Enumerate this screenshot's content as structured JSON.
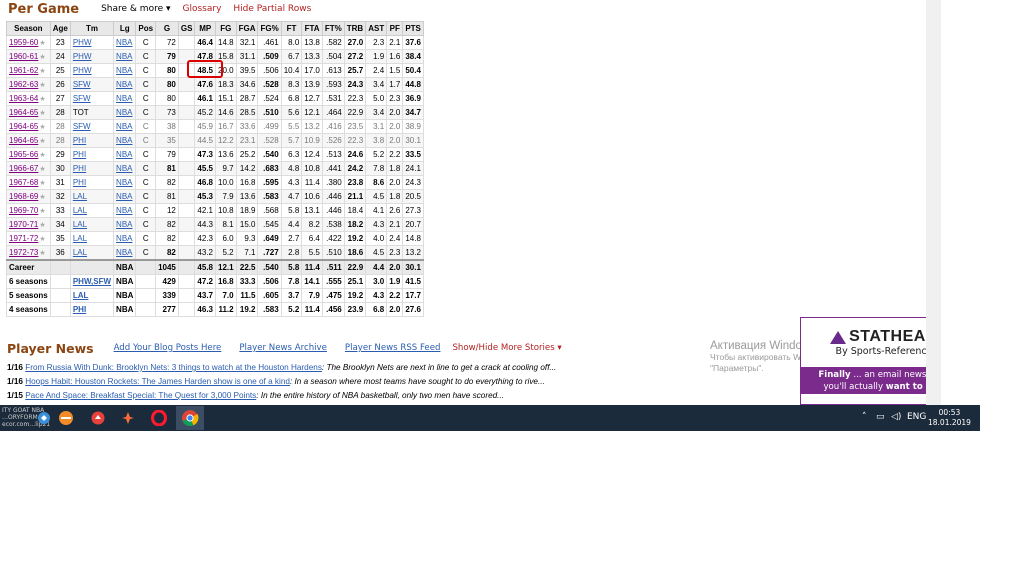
{
  "section": {
    "title": "Per Game",
    "share_label": "Share & more ▾",
    "glossary_label": "Glossary",
    "hide_partial_label": "Hide Partial Rows"
  },
  "table": {
    "headers": [
      "Season",
      "Age",
      "Tm",
      "Lg",
      "Pos",
      "G",
      "GS",
      "MP",
      "FG",
      "FGA",
      "FG%",
      "FT",
      "FTA",
      "FT%",
      "TRB",
      "AST",
      "PF",
      "PTS"
    ],
    "rows": [
      {
        "season": "1959-60",
        "age": "23",
        "tm": "PHW",
        "lg": "NBA",
        "pos": "C",
        "g": "72",
        "gs": "",
        "mp": "46.4",
        "fg": "14.8",
        "fga": "32.1",
        "fgp": ".461",
        "ft": "8.0",
        "fta": "13.8",
        "ftp": ".582",
        "trb": "27.0",
        "ast": "2.3",
        "pf": "2.1",
        "pts": "37.6",
        "bold": [
          "mp",
          "trb",
          "pts"
        ]
      },
      {
        "season": "1960-61",
        "age": "24",
        "tm": "PHW",
        "lg": "NBA",
        "pos": "C",
        "g": "79",
        "gs": "",
        "mp": "47.8",
        "fg": "15.8",
        "fga": "31.1",
        "fgp": ".509",
        "ft": "6.7",
        "fta": "13.3",
        "ftp": ".504",
        "trb": "27.2",
        "ast": "1.9",
        "pf": "1.6",
        "pts": "38.4",
        "bold": [
          "g",
          "mp",
          "fgp",
          "trb",
          "pts"
        ]
      },
      {
        "season": "1961-62",
        "age": "25",
        "tm": "PHW",
        "lg": "NBA",
        "pos": "C",
        "g": "80",
        "gs": "",
        "mp": "48.5",
        "fg": "20.0",
        "fga": "39.5",
        "fgp": ".506",
        "ft": "10.4",
        "fta": "17.0",
        "ftp": ".613",
        "trb": "25.7",
        "ast": "2.4",
        "pf": "1.5",
        "pts": "50.4",
        "bold": [
          "g",
          "mp",
          "trb",
          "pts"
        ]
      },
      {
        "season": "1962-63",
        "age": "26",
        "tm": "SFW",
        "lg": "NBA",
        "pos": "C",
        "g": "80",
        "gs": "",
        "mp": "47.6",
        "fg": "18.3",
        "fga": "34.6",
        "fgp": ".528",
        "ft": "8.3",
        "fta": "13.9",
        "ftp": ".593",
        "trb": "24.3",
        "ast": "3.4",
        "pf": "1.7",
        "pts": "44.8",
        "bold": [
          "g",
          "mp",
          "fgp",
          "trb",
          "pts"
        ]
      },
      {
        "season": "1963-64",
        "age": "27",
        "tm": "SFW",
        "lg": "NBA",
        "pos": "C",
        "g": "80",
        "gs": "",
        "mp": "46.1",
        "fg": "15.1",
        "fga": "28.7",
        "fgp": ".524",
        "ft": "6.8",
        "fta": "12.7",
        "ftp": ".531",
        "trb": "22.3",
        "ast": "5.0",
        "pf": "2.3",
        "pts": "36.9",
        "bold": [
          "mp",
          "pts"
        ]
      },
      {
        "season": "1964-65",
        "age": "28",
        "tm": "TOT",
        "lg": "NBA",
        "pos": "C",
        "g": "73",
        "gs": "",
        "mp": "45.2",
        "fg": "14.6",
        "fga": "28.5",
        "fgp": ".510",
        "ft": "5.6",
        "fta": "12.1",
        "ftp": ".464",
        "trb": "22.9",
        "ast": "3.4",
        "pf": "2.0",
        "pts": "34.7",
        "bold": [
          "fgp",
          "pts"
        ]
      },
      {
        "season": "1964-65",
        "age": "28",
        "tm": "SFW",
        "lg": "NBA",
        "pos": "C",
        "g": "38",
        "gs": "",
        "mp": "45.9",
        "fg": "16.7",
        "fga": "33.6",
        "fgp": ".499",
        "ft": "5.5",
        "fta": "13.2",
        "ftp": ".416",
        "trb": "23.5",
        "ast": "3.1",
        "pf": "2.0",
        "pts": "38.9",
        "bold": [],
        "partial": true
      },
      {
        "season": "1964-65",
        "age": "28",
        "tm": "PHI",
        "lg": "NBA",
        "pos": "C",
        "g": "35",
        "gs": "",
        "mp": "44.5",
        "fg": "12.2",
        "fga": "23.1",
        "fgp": ".528",
        "ft": "5.7",
        "fta": "10.9",
        "ftp": ".526",
        "trb": "22.3",
        "ast": "3.8",
        "pf": "2.0",
        "pts": "30.1",
        "bold": [],
        "partial": true
      },
      {
        "season": "1965-66",
        "age": "29",
        "tm": "PHI",
        "lg": "NBA",
        "pos": "C",
        "g": "79",
        "gs": "",
        "mp": "47.3",
        "fg": "13.6",
        "fga": "25.2",
        "fgp": ".540",
        "ft": "6.3",
        "fta": "12.4",
        "ftp": ".513",
        "trb": "24.6",
        "ast": "5.2",
        "pf": "2.2",
        "pts": "33.5",
        "bold": [
          "mp",
          "fgp",
          "trb",
          "pts"
        ]
      },
      {
        "season": "1966-67",
        "age": "30",
        "tm": "PHI",
        "lg": "NBA",
        "pos": "C",
        "g": "81",
        "gs": "",
        "mp": "45.5",
        "fg": "9.7",
        "fga": "14.2",
        "fgp": ".683",
        "ft": "4.8",
        "fta": "10.8",
        "ftp": ".441",
        "trb": "24.2",
        "ast": "7.8",
        "pf": "1.8",
        "pts": "24.1",
        "bold": [
          "g",
          "mp",
          "fgp",
          "trb"
        ]
      },
      {
        "season": "1967-68",
        "age": "31",
        "tm": "PHI",
        "lg": "NBA",
        "pos": "C",
        "g": "82",
        "gs": "",
        "mp": "46.8",
        "fg": "10.0",
        "fga": "16.8",
        "fgp": ".595",
        "ft": "4.3",
        "fta": "11.4",
        "ftp": ".380",
        "trb": "23.8",
        "ast": "8.6",
        "pf": "2.0",
        "pts": "24.3",
        "bold": [
          "mp",
          "fgp",
          "trb",
          "ast"
        ]
      },
      {
        "season": "1968-69",
        "age": "32",
        "tm": "LAL",
        "lg": "NBA",
        "pos": "C",
        "g": "81",
        "gs": "",
        "mp": "45.3",
        "fg": "7.9",
        "fga": "13.6",
        "fgp": ".583",
        "ft": "4.7",
        "fta": "10.6",
        "ftp": ".446",
        "trb": "21.1",
        "ast": "4.5",
        "pf": "1.8",
        "pts": "20.5",
        "bold": [
          "mp",
          "fgp",
          "trb"
        ]
      },
      {
        "season": "1969-70",
        "age": "33",
        "tm": "LAL",
        "lg": "NBA",
        "pos": "C",
        "g": "12",
        "gs": "",
        "mp": "42.1",
        "fg": "10.8",
        "fga": "18.9",
        "fgp": ".568",
        "ft": "5.8",
        "fta": "13.1",
        "ftp": ".446",
        "trb": "18.4",
        "ast": "4.1",
        "pf": "2.6",
        "pts": "27.3",
        "bold": []
      },
      {
        "season": "1970-71",
        "age": "34",
        "tm": "LAL",
        "lg": "NBA",
        "pos": "C",
        "g": "82",
        "gs": "",
        "mp": "44.3",
        "fg": "8.1",
        "fga": "15.0",
        "fgp": ".545",
        "ft": "4.4",
        "fta": "8.2",
        "ftp": ".538",
        "trb": "18.2",
        "ast": "4.3",
        "pf": "2.1",
        "pts": "20.7",
        "bold": [
          "trb"
        ]
      },
      {
        "season": "1971-72",
        "age": "35",
        "tm": "LAL",
        "lg": "NBA",
        "pos": "C",
        "g": "82",
        "gs": "",
        "mp": "42.3",
        "fg": "6.0",
        "fga": "9.3",
        "fgp": ".649",
        "ft": "2.7",
        "fta": "6.4",
        "ftp": ".422",
        "trb": "19.2",
        "ast": "4.0",
        "pf": "2.4",
        "pts": "14.8",
        "bold": [
          "fgp",
          "trb"
        ]
      },
      {
        "season": "1972-73",
        "age": "36",
        "tm": "LAL",
        "lg": "NBA",
        "pos": "C",
        "g": "82",
        "gs": "",
        "mp": "43.2",
        "fg": "5.2",
        "fga": "7.1",
        "fgp": ".727",
        "ft": "2.8",
        "fta": "5.5",
        "ftp": ".510",
        "trb": "18.6",
        "ast": "4.5",
        "pf": "2.3",
        "pts": "13.2",
        "bold": [
          "g",
          "fgp",
          "trb"
        ]
      }
    ],
    "career": {
      "label": "Career",
      "lg": "NBA",
      "g": "1045",
      "mp": "45.8",
      "fg": "12.1",
      "fga": "22.5",
      "fgp": ".540",
      "ft": "5.8",
      "fta": "11.4",
      "ftp": ".511",
      "trb": "22.9",
      "ast": "4.4",
      "pf": "2.0",
      "pts": "30.1"
    },
    "summaries": [
      {
        "label": "6 seasons",
        "tm": "PHW,SFW",
        "lg": "NBA",
        "g": "429",
        "mp": "47.2",
        "fg": "16.8",
        "fga": "33.3",
        "fgp": ".506",
        "ft": "7.8",
        "fta": "14.1",
        "ftp": ".555",
        "trb": "25.1",
        "ast": "3.0",
        "pf": "1.9",
        "pts": "41.5"
      },
      {
        "label": "5 seasons",
        "tm": "LAL",
        "lg": "NBA",
        "g": "339",
        "mp": "43.7",
        "fg": "7.0",
        "fga": "11.5",
        "fgp": ".605",
        "ft": "3.7",
        "fta": "7.9",
        "ftp": ".475",
        "trb": "19.2",
        "ast": "4.3",
        "pf": "2.2",
        "pts": "17.7"
      },
      {
        "label": "4 seasons",
        "tm": "PHI",
        "lg": "NBA",
        "g": "277",
        "mp": "46.3",
        "fg": "11.2",
        "fga": "19.2",
        "fgp": ".583",
        "ft": "5.2",
        "fta": "11.4",
        "ftp": ".456",
        "trb": "23.9",
        "ast": "6.8",
        "pf": "2.0",
        "pts": "27.6"
      }
    ]
  },
  "player_news": {
    "title": "Player News",
    "links": [
      "Add Your Blog Posts Here",
      "Player News Archive",
      "Player News RSS Feed"
    ],
    "show_hide": "Show/Hide More Stories ▾",
    "items": [
      {
        "date": "1/16",
        "link": "From Russia With Dunk: Brooklyn Nets: 3 things to watch at the Houston Hardens",
        "text": ": The Brooklyn Nets are next in line to get a crack at cooling off..."
      },
      {
        "date": "1/16",
        "link": "Hoops Habit: Houston Rockets: The James Harden show is one of a kind",
        "text": ": In a season where most teams have sought to do everything to rive..."
      },
      {
        "date": "1/15",
        "link": "Pace And Space: Breakfast Special: The Quest for 3,000 Points",
        "text": ": In the entire history of NBA basketball, only two men have scored..."
      }
    ]
  },
  "activation": {
    "title": "Активация Windows",
    "line1": "Чтобы активировать Windows, перейдите в раздел",
    "line2": "\"Параметры\"."
  },
  "stathead": {
    "name": "STATHEAD",
    "by": "By Sports-Reference",
    "band_bold1": "Finally",
    "band_text1": " ... an email newsletter",
    "band_text2": "you'll actually ",
    "band_bold2": "want to get",
    "band_text3": "."
  },
  "taskbar": {
    "label_line1": "ITY GOAT NBA",
    "label_line2": "…ORYFORM…ecor.com…lip21",
    "lang": "ENG",
    "time": "00:53",
    "date": "18.01.2019"
  },
  "colors": {
    "accent": "#8b4513",
    "link": "#2a5db0",
    "visited": "#800080",
    "alert": "#b22222",
    "stathead": "#7a2b8c",
    "taskbar": "#1c2b3c"
  }
}
